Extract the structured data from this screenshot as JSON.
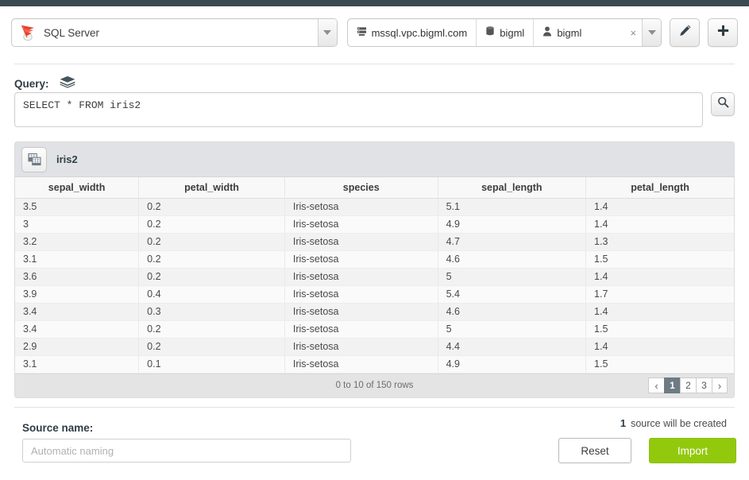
{
  "toolbar": {
    "engine": {
      "label": "SQL Server",
      "icon": "sql-server-logo"
    },
    "connection": {
      "host": "mssql.vpc.bigml.com",
      "database": "bigml",
      "user": "bigml",
      "clear_label": "×"
    },
    "edit_button_icon": "pencil-icon",
    "add_button_icon": "plus-icon"
  },
  "query": {
    "label": "Query:",
    "icon": "layers-icon",
    "sql": "SELECT * FROM iris2",
    "run_icon": "search-icon"
  },
  "results": {
    "title": "iris2",
    "icon": "table-icon",
    "columns": [
      "sepal_width",
      "petal_width",
      "species",
      "sepal_length",
      "petal_length"
    ],
    "rows": [
      [
        "3.5",
        "0.2",
        "Iris-setosa",
        "5.1",
        "1.4"
      ],
      [
        "3",
        "0.2",
        "Iris-setosa",
        "4.9",
        "1.4"
      ],
      [
        "3.2",
        "0.2",
        "Iris-setosa",
        "4.7",
        "1.3"
      ],
      [
        "3.1",
        "0.2",
        "Iris-setosa",
        "4.6",
        "1.5"
      ],
      [
        "3.6",
        "0.2",
        "Iris-setosa",
        "5",
        "1.4"
      ],
      [
        "3.9",
        "0.4",
        "Iris-setosa",
        "5.4",
        "1.7"
      ],
      [
        "3.4",
        "0.3",
        "Iris-setosa",
        "4.6",
        "1.4"
      ],
      [
        "3.4",
        "0.2",
        "Iris-setosa",
        "5",
        "1.5"
      ],
      [
        "2.9",
        "0.2",
        "Iris-setosa",
        "4.4",
        "1.4"
      ],
      [
        "3.1",
        "0.1",
        "Iris-setosa",
        "4.9",
        "1.5"
      ]
    ],
    "row_count_text": "0 to 10 of 150 rows",
    "pagination": {
      "prev": "‹",
      "pages": [
        "1",
        "2",
        "3"
      ],
      "active": "1",
      "next": "›"
    }
  },
  "footer": {
    "source_name_label": "Source name:",
    "source_name_value": "",
    "source_name_placeholder": "Automatic naming",
    "created_count": "1",
    "created_text": "source will be created",
    "reset_label": "Reset",
    "import_label": "Import"
  },
  "colors": {
    "top_strip": "#3b4a51",
    "import_green": "#93c90d",
    "panel_header": "#e0e2e6",
    "pager_active": "#6d7b85"
  }
}
